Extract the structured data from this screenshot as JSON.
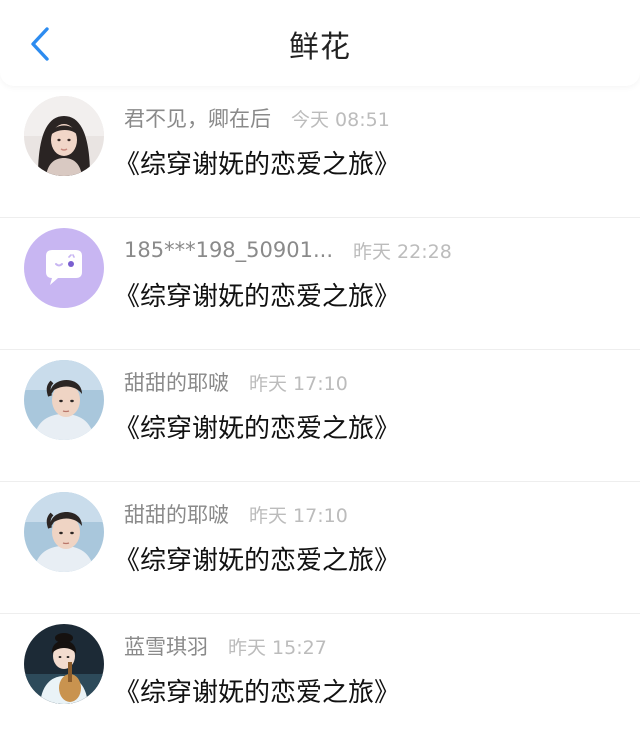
{
  "header": {
    "title": "鲜花",
    "back_icon": "chevron-left-icon",
    "accent_color": "#2d8cf0"
  },
  "rows": [
    {
      "user": "君不见，卿在后",
      "time": "今天 08:51",
      "book": "《综穿谢妩的恋爱之旅》",
      "avatar": "avatar-photo-woman"
    },
    {
      "user": "185***198_50901...",
      "time": "昨天 22:28",
      "book": "《综穿谢妩的恋爱之旅》",
      "avatar": "default-chat-bubble-icon"
    },
    {
      "user": "甜甜的耶啵",
      "time": "昨天 17:10",
      "book": "《综穿谢妩的恋爱之旅》",
      "avatar": "avatar-photo-man"
    },
    {
      "user": "甜甜的耶啵",
      "time": "昨天 17:10",
      "book": "《综穿谢妩的恋爱之旅》",
      "avatar": "avatar-photo-man"
    },
    {
      "user": "蓝雪琪羽",
      "time": "昨天 15:27",
      "book": "《综穿谢妩的恋爱之旅》",
      "avatar": "avatar-photo-musician"
    }
  ]
}
